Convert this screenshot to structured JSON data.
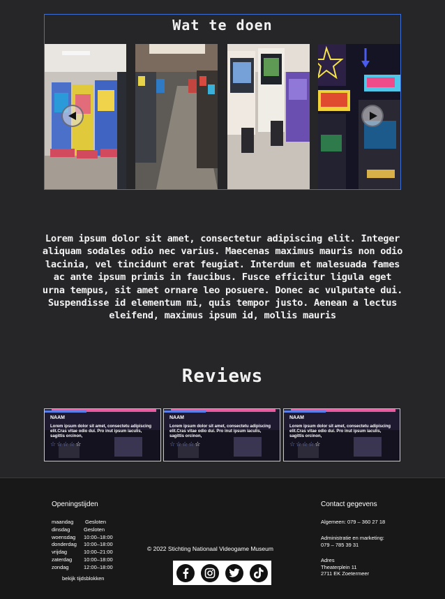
{
  "activities": {
    "title": "Wat te doen"
  },
  "intro": {
    "text": "Lorem ipsum dolor sit amet, consectetur adipiscing elit. Integer aliquam sodales odio nec varius. Maecenas maximus mauris non odio lacinia, vel tincidunt erat feugiat. Interdum et malesuada fames ac ante ipsum primis in faucibus. Fusce efficitur ligula eget urna tempus, sit amet ornare leo posuere. Donec ac vulputate dui. Suspendisse id elementum mi, quis tempor justo. Aenean a lectus eleifend, maximus ipsum id, mollis mauris"
  },
  "reviews": {
    "title": "Reviews",
    "items": [
      {
        "name": "NAAM",
        "text": "Lorem ipsum dolor sit amet, consectetu adipiscing elit.Cras vitae odio dui. Pro inut ipsum iaculis, sagittis orcinon,",
        "stars": "☆☆☆☆☆"
      },
      {
        "name": "NAAM",
        "text": "Lorem ipsum dolor sit amet, consectetu adipiscing elit.Cras vitae odio dui. Pro inut ipsum iaculis, sagittis orcinon,",
        "stars": "☆☆☆☆☆"
      },
      {
        "name": "NAAM",
        "text": "Lorem ipsum dolor sit amet, consectetu adipiscing elit.Cras vitae odio dui. Pro inut ipsum iaculis, sagittis orcinon,",
        "stars": "☆☆☆☆☆"
      }
    ]
  },
  "footer": {
    "hours_title": "Openingstijden",
    "hours": [
      {
        "day": "maandag",
        "time": "Gesloten"
      },
      {
        "day": "dinsdag",
        "time": "Gesloten"
      },
      {
        "day": "woensdag",
        "time": "10:00–18:00"
      },
      {
        "day": "donderdag",
        "time": "10:00–18:00"
      },
      {
        "day": "vrijdag",
        "time": "10:00–21:00"
      },
      {
        "day": "zaterdag",
        "time": "10:00–18:00"
      },
      {
        "day": "zondag",
        "time": "12:00–18:00"
      }
    ],
    "time_blocks_link": "bekijk tijdsblokken",
    "copyright": "© 2022 Stichting Nationaal Videogame Museum",
    "contact_title": "Contact gegevens",
    "general": "Algemeen: 079 – 360 27 18",
    "admin_label": "Administratie en marketing:",
    "admin_phone": "079 – 785 39 31",
    "address_label": "Adres",
    "address_street": "Theaterplein 11",
    "address_city": "2711 EK Zoetermeer",
    "social_icons": [
      "facebook-icon",
      "instagram-icon",
      "twitter-icon",
      "tiktok-icon"
    ]
  }
}
